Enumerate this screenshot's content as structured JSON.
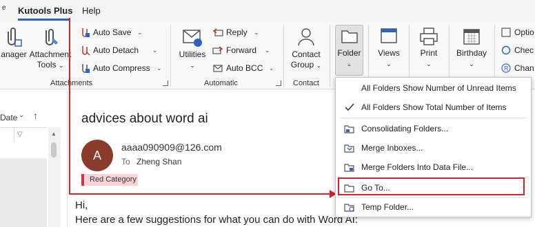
{
  "tabs": {
    "left_fragment": "e",
    "active": "Kutools Plus",
    "help": "Help"
  },
  "ribbon": {
    "manager": "anager",
    "attachment_tools": [
      "Attachment",
      "Tools"
    ],
    "auto_save": "Auto Save",
    "auto_detach": "Auto Detach",
    "auto_compress": "Auto Compress",
    "attachments_group": "Attachments",
    "utilities": "Utilities",
    "reply": "Reply",
    "forward": "Forward",
    "auto_bcc": "Auto BCC",
    "automatic_group": "Automatic",
    "contact_group_btn": [
      "Contact",
      "Group"
    ],
    "contact_group": "Contact",
    "folder": "Folder",
    "views": "Views",
    "print": "Print",
    "birthday": "Birthday",
    "option": "Optio",
    "check": "Chec",
    "change": "Chan"
  },
  "left_pane": {
    "sort_label": "Date"
  },
  "email": {
    "subject": "advices about word ai",
    "avatar_letter": "A",
    "from": "aaaa090909@126.com",
    "to_label": "To",
    "to_value": "Zheng Shan",
    "category": "Red Category",
    "body_line1": "Hi,",
    "body_line2": "Here are a few suggestions for what you can do with Word AI:"
  },
  "folder_menu": {
    "items": [
      {
        "label": "All Folders Show Number of Unread Items",
        "icon": "none"
      },
      {
        "label": "All Folders Show Total Number of Items",
        "icon": "checkmark-icon"
      },
      {
        "label": "Consolidating Folders...",
        "icon": "folders-icon"
      },
      {
        "label": "Merge Inboxes...",
        "icon": "merge-inbox-icon"
      },
      {
        "label": "Merge Folders Into Data File...",
        "icon": "merge-folder-icon"
      },
      {
        "label": "Go To...",
        "icon": "folder-icon"
      },
      {
        "label": "Temp Folder...",
        "icon": "temp-folder-icon"
      }
    ]
  },
  "colors": {
    "accent": "#2b63c4",
    "annotation_red": "#d1232a",
    "avatar": "#8b3b2b",
    "category": "#f7d3d8"
  }
}
